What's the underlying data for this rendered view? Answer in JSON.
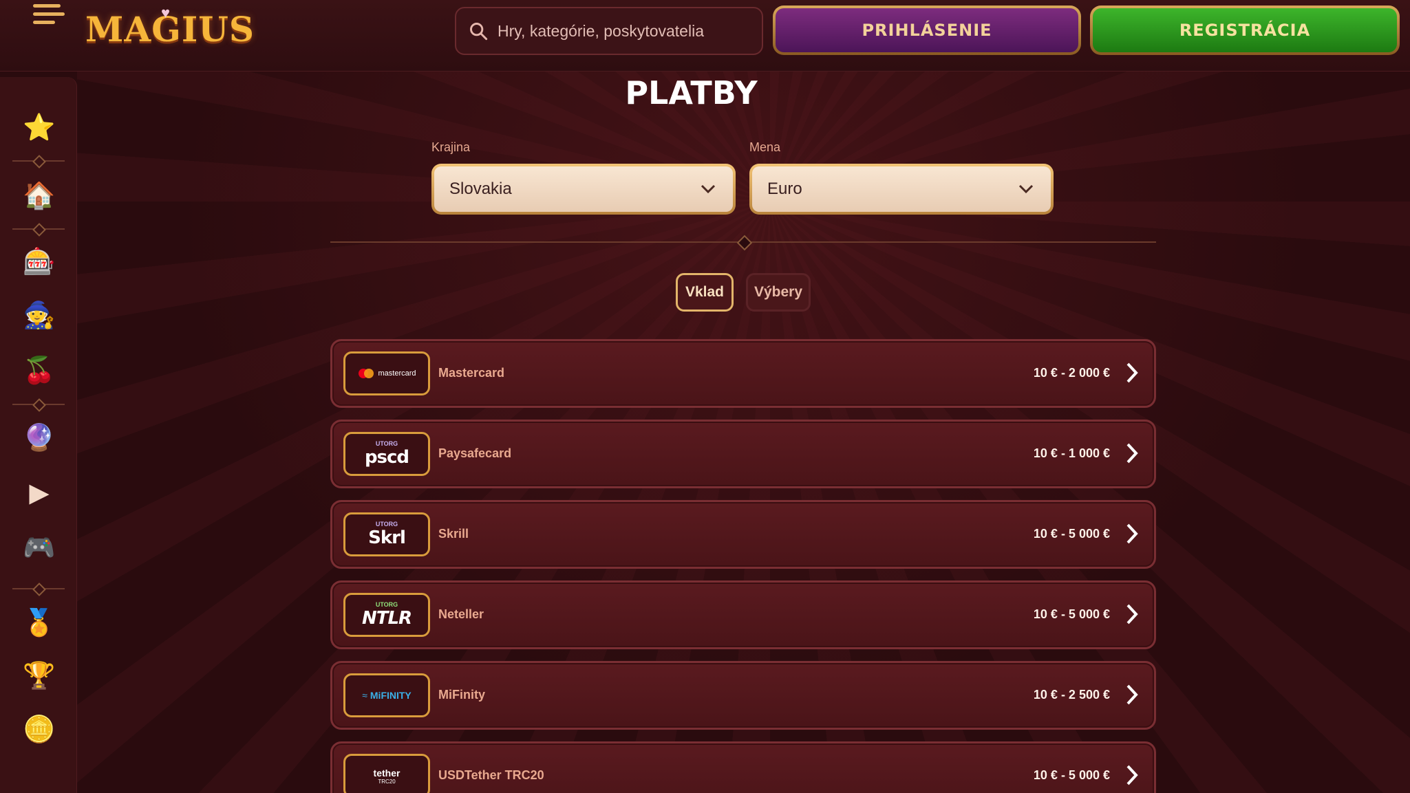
{
  "header": {
    "logo_text": "MAGIUS",
    "search_placeholder": "Hry, kategórie, poskytovatelia",
    "login_label": "PRIHLÁSENIE",
    "register_label": "REGISTRÁCIA"
  },
  "sidebar": {
    "items": [
      {
        "name": "promotions",
        "icon": "star-gift-icon"
      },
      {
        "name": "home",
        "icon": "house-icon"
      },
      {
        "name": "slots",
        "icon": "slot-reels-icon"
      },
      {
        "name": "live",
        "icon": "wizard-hat-icon"
      },
      {
        "name": "jackpot",
        "icon": "seven-icon"
      },
      {
        "name": "crystal",
        "icon": "crystal-ball-icon"
      },
      {
        "name": "video",
        "icon": "play-icon"
      },
      {
        "name": "games",
        "icon": "gamepad-icon"
      },
      {
        "name": "bonus",
        "icon": "medal-icon"
      },
      {
        "name": "tournaments",
        "icon": "trophy-icon"
      },
      {
        "name": "shop",
        "icon": "coin-icon"
      }
    ],
    "language_icon": "flag-icon",
    "chat_icon": "chat-icon"
  },
  "page": {
    "title": "PLATBY",
    "country_label": "Krajina",
    "country_value": "Slovakia",
    "currency_label": "Mena",
    "currency_value": "Euro",
    "tabs": [
      {
        "label": "Vklad",
        "active": true
      },
      {
        "label": "Výbery",
        "active": false
      }
    ]
  },
  "payments": [
    {
      "name": "Mastercard",
      "range": "10 € - 2 000 €",
      "logo": "mastercard"
    },
    {
      "name": "Paysafecard",
      "range": "10 € - 1 000 €",
      "logo": "pscd"
    },
    {
      "name": "Skrill",
      "range": "10 € - 5 000 €",
      "logo": "Skrl"
    },
    {
      "name": "Neteller",
      "range": "10 € - 5 000 €",
      "logo": "NTLR"
    },
    {
      "name": "MiFinity",
      "range": "10 € - 2 500 €",
      "logo": "MiFINITY"
    },
    {
      "name": "USDTether TRC20",
      "range": "10 € - 5 000 €",
      "logo": "tether"
    }
  ],
  "logo_badges": {
    "utorg": "UTORG",
    "trc20": "TRC20"
  },
  "colors": {
    "background": "#2a0b0e",
    "accent_gold": "#e3b56a",
    "login": "#6a2370",
    "register": "#2f9a20"
  }
}
